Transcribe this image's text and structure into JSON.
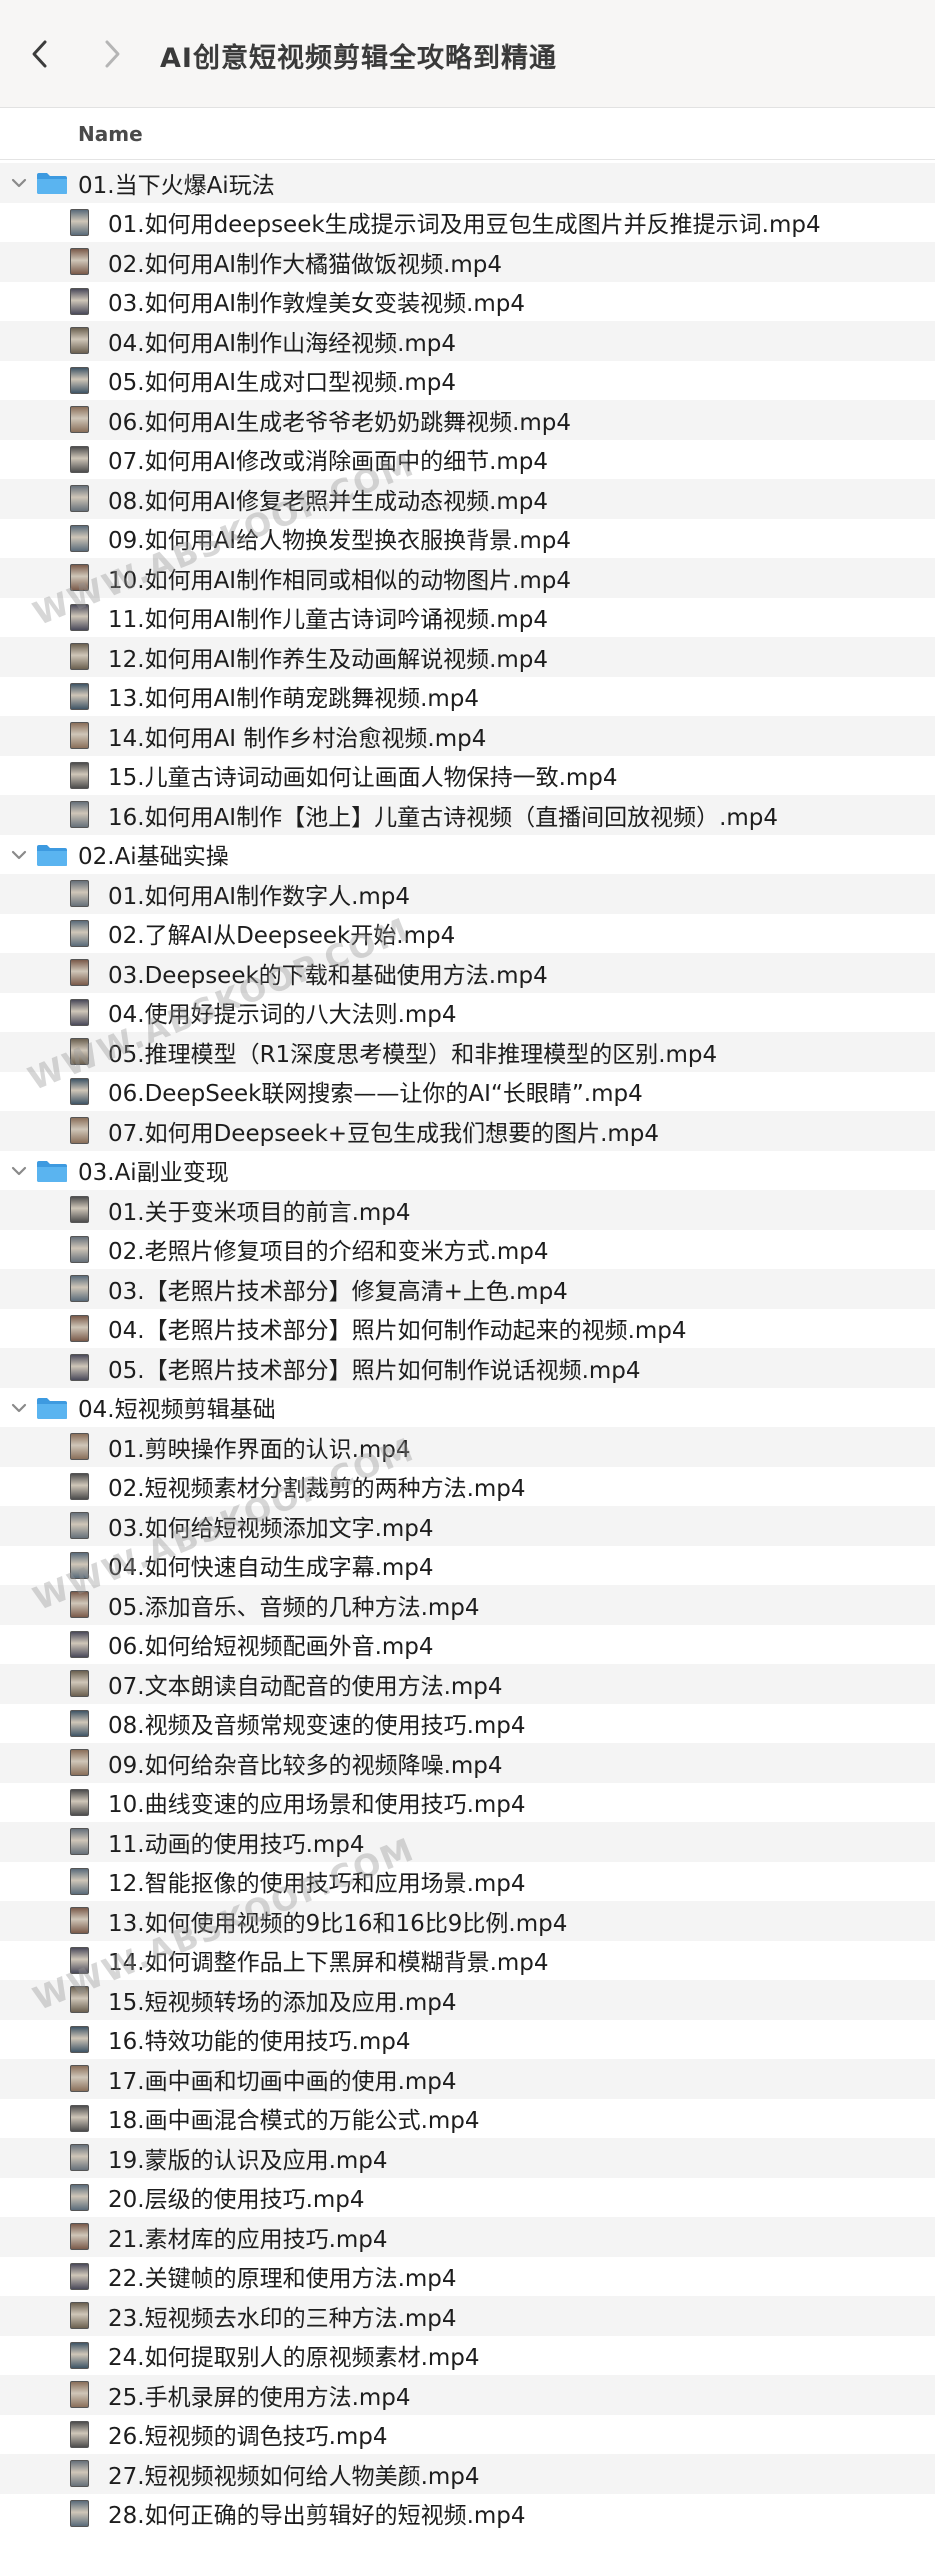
{
  "window": {
    "title": "AI创意短视频剪辑全攻略到精通"
  },
  "header": {
    "name_column": "Name"
  },
  "watermark": "WWW.ABSKOOP.COM",
  "colors": {
    "folder_blue": "#4aa8e8",
    "stripe": "#f4f4f4"
  },
  "icons": {
    "back": "chevron-left-icon",
    "forward": "chevron-right-icon",
    "disclosure": "chevron-down-icon",
    "folder": "folder-icon",
    "file": "video-thumbnail-icon"
  },
  "folders": [
    {
      "name": "01.当下火爆Ai玩法",
      "files": [
        "01.如何用deepseek生成提示词及用豆包生成图片并反推提示词.mp4",
        "02.如何用AI制作大橘猫做饭视频.mp4",
        "03.如何用AI制作敦煌美女变装视频.mp4",
        "04.如何用AI制作山海经视频.mp4",
        "05.如何用AI生成对口型视频.mp4",
        "06.如何用AI生成老爷爷老奶奶跳舞视频.mp4",
        "07.如何用AI修改或消除画面中的细节.mp4",
        "08.如何用AI修复老照并生成动态视频.mp4",
        "09.如何用AI给人物换发型换衣服换背景.mp4",
        "10.如何用AI制作相同或相似的动物图片.mp4",
        "11.如何用AI制作儿童古诗词吟诵视频.mp4",
        "12.如何用AI制作养生及动画解说视频.mp4",
        "13.如何用AI制作萌宠跳舞视频.mp4",
        "14.如何用AI 制作乡村治愈视频.mp4",
        "15.儿童古诗词动画如何让画面人物保持一致.mp4",
        "16.如何用AI制作【池上】儿童古诗视频（直播间回放视频）.mp4"
      ]
    },
    {
      "name": "02.Ai基础实操",
      "files": [
        "01.如何用AI制作数字人.mp4",
        "02.了解AI从Deepseek开始.mp4",
        "03.Deepseek的下载和基础使用方法.mp4",
        "04.使用好提示词的八大法则.mp4",
        "05.推理模型（R1深度思考模型）和非推理模型的区别.mp4",
        "06.DeepSeek联网搜索——让你的AI“长眼睛”.mp4",
        "07.如何用Deepseek+豆包生成我们想要的图片.mp4"
      ]
    },
    {
      "name": "03.Ai副业变现",
      "files": [
        "01.关于变米项目的前言.mp4",
        "02.老照片修复项目的介绍和变米方式.mp4",
        "03.【老照片技术部分】修复高清+上色.mp4",
        "04.【老照片技术部分】照片如何制作动起来的视频.mp4",
        "05.【老照片技术部分】照片如何制作说话视频.mp4"
      ]
    },
    {
      "name": "04.短视频剪辑基础",
      "files": [
        "01.剪映操作界面的认识.mp4",
        "02.短视频素材分割裁剪的两种方法.mp4",
        "03.如何给短视频添加文字.mp4",
        "04.如何快速自动生成字幕.mp4",
        "05.添加音乐、音频的几种方法.mp4",
        "06.如何给短视频配画外音.mp4",
        "07.文本朗读自动配音的使用方法.mp4",
        "08.视频及音频常规变速的使用技巧.mp4",
        "09.如何给杂音比较多的视频降噪.mp4",
        "10.曲线变速的应用场景和使用技巧.mp4",
        "11.动画的使用技巧.mp4",
        "12.智能抠像的使用技巧和应用场景.mp4",
        "13.如何使用视频的9比16和16比9比例.mp4",
        "14.如何调整作品上下黑屏和模糊背景.mp4",
        "15.短视频转场的添加及应用.mp4",
        "16.特效功能的使用技巧.mp4",
        "17.画中画和切画中画的使用.mp4",
        "18.画中画混合模式的万能公式.mp4",
        "19.蒙版的认识及应用.mp4",
        "20.层级的使用技巧.mp4",
        "21.素材库的应用技巧.mp4",
        "22.关键帧的原理和使用方法.mp4",
        "23.短视频去水印的三种方法.mp4",
        "24.如何提取别人的原视频素材.mp4",
        "25.手机录屏的使用方法.mp4",
        "26.短视频的调色技巧.mp4",
        "27.短视频视频如何给人物美颜.mp4",
        "28.如何正确的导出剪辑好的短视频.mp4"
      ]
    }
  ]
}
